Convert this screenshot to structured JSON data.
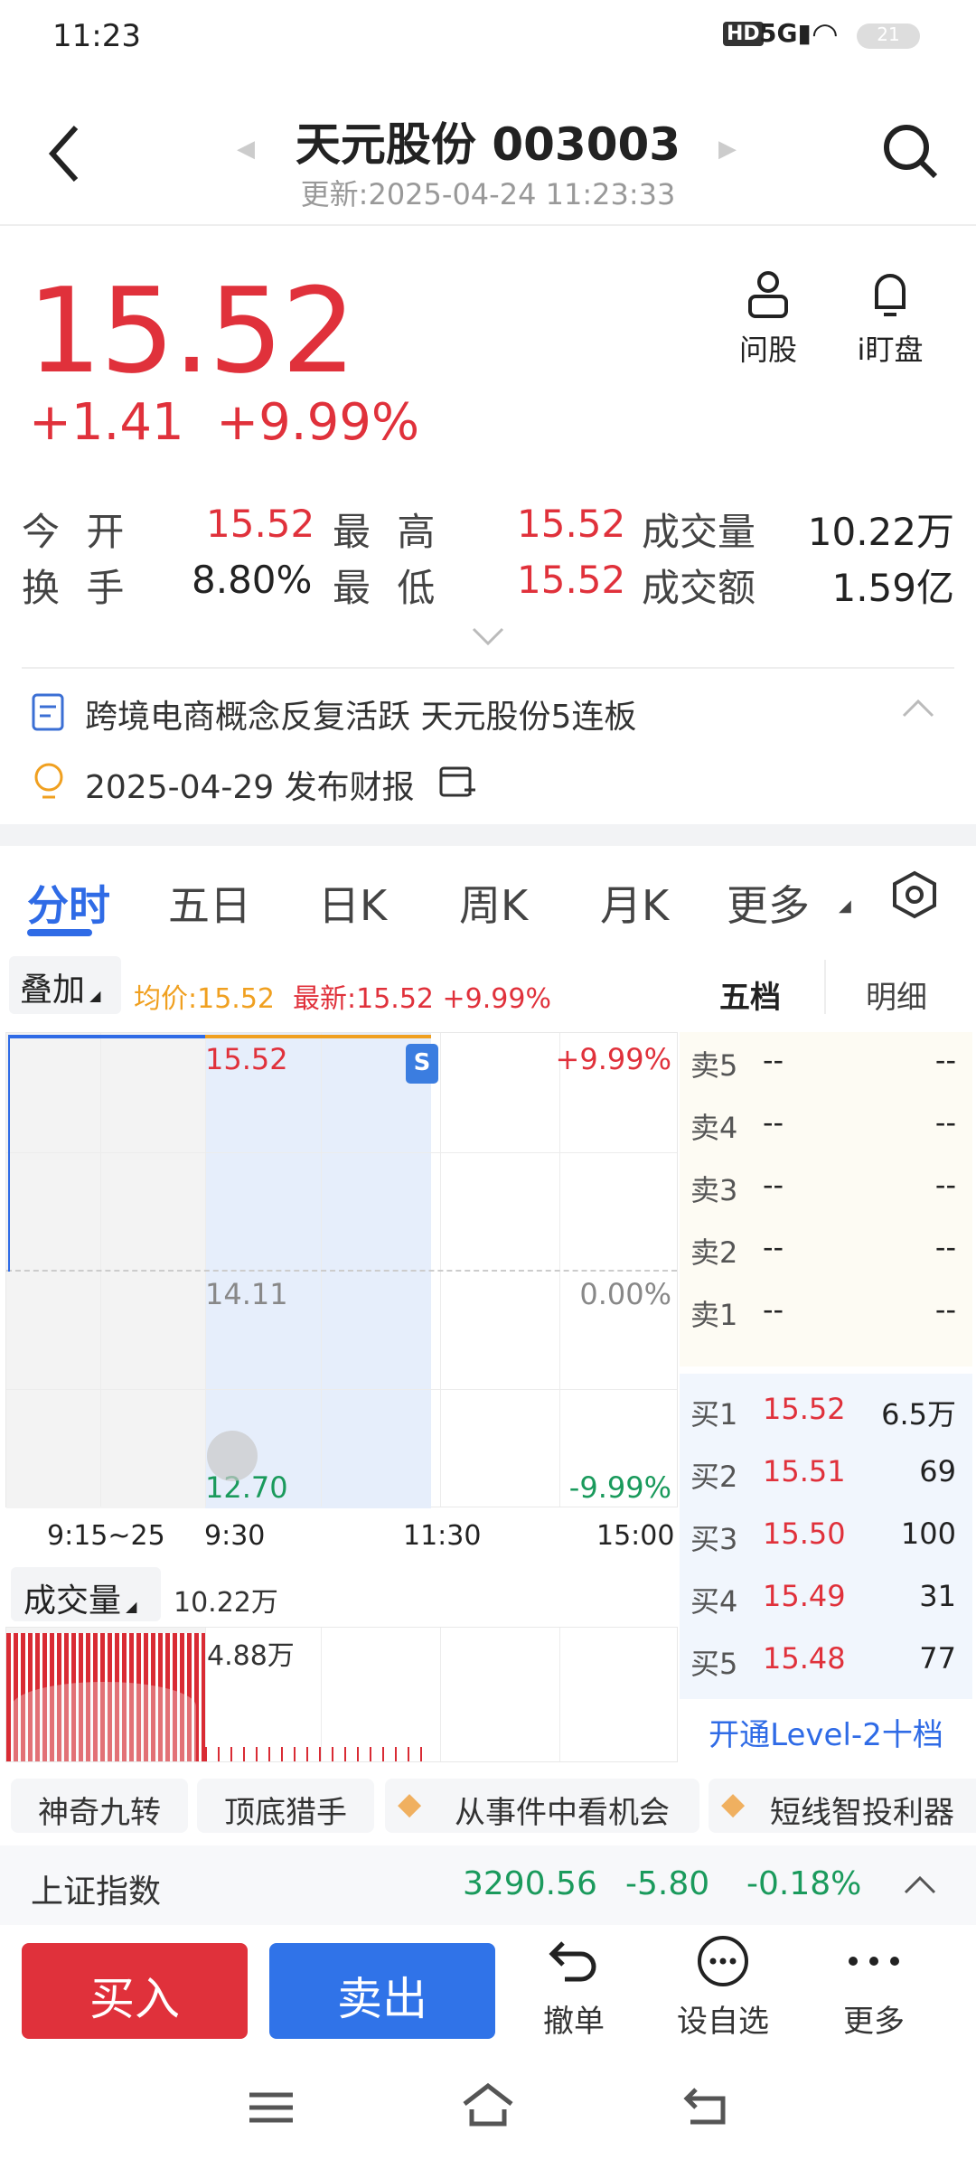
{
  "status": {
    "time": "11:23",
    "battery": "21"
  },
  "header": {
    "title": "天元股份 003003",
    "updated": "更新:2025-04-24 11:23:33"
  },
  "price": {
    "last": "15.52",
    "change": "+1.41",
    "pct": "+9.99%"
  },
  "actions": {
    "ask": "问股",
    "watch": "i盯盘"
  },
  "quote": {
    "open_label": "今 开",
    "open": "15.52",
    "high_label": "最 高",
    "high": "15.52",
    "vol_label": "成交量",
    "vol": "10.22万",
    "turn_label": "换 手",
    "turn": "8.80%",
    "low_label": "最 低",
    "low": "15.52",
    "amt_label": "成交额",
    "amt": "1.59亿"
  },
  "news": {
    "headline": "跨境电商概念反复活跃 天元股份5连板",
    "event": "2025-04-29 发布财报"
  },
  "tabs": [
    "分时",
    "五日",
    "日K",
    "周K",
    "月K",
    "更多"
  ],
  "overlay": {
    "label": "叠加",
    "avg": "均价:15.52",
    "latest": "最新:15.52 +9.99%"
  },
  "obtabs": {
    "five": "五档",
    "detail": "明细"
  },
  "chart": {
    "top_price": "15.52",
    "top_pct": "+9.99%",
    "mid_price": "14.11",
    "mid_pct": "0.00%",
    "low_price": "12.70",
    "low_pct": "-9.99%",
    "times": [
      "9:15~25",
      "9:30",
      "11:30",
      "15:00"
    ],
    "vol_label": "成交量",
    "vol_total": "10.22万",
    "vol_max": "4.88万",
    "marker": "S"
  },
  "orderbook": {
    "sells": [
      {
        "l": "卖5",
        "p": "--",
        "v": "--"
      },
      {
        "l": "卖4",
        "p": "--",
        "v": "--"
      },
      {
        "l": "卖3",
        "p": "--",
        "v": "--"
      },
      {
        "l": "卖2",
        "p": "--",
        "v": "--"
      },
      {
        "l": "卖1",
        "p": "--",
        "v": "--"
      }
    ],
    "buys": [
      {
        "l": "买1",
        "p": "15.52",
        "v": "6.5万"
      },
      {
        "l": "买2",
        "p": "15.51",
        "v": "69"
      },
      {
        "l": "买3",
        "p": "15.50",
        "v": "100"
      },
      {
        "l": "买4",
        "p": "15.49",
        "v": "31"
      },
      {
        "l": "买5",
        "p": "15.48",
        "v": "77"
      }
    ],
    "level2": "开通Level-2十档"
  },
  "tags": [
    "神奇九转",
    "顶底猎手",
    "从事件中看机会",
    "短线智投利器"
  ],
  "index": {
    "name": "上证指数",
    "value": "3290.56",
    "change": "-5.80",
    "pct": "-0.18%"
  },
  "bottom": {
    "buy": "买入",
    "sell": "卖出",
    "cancel": "撤单",
    "fav": "设自选",
    "more": "更多"
  }
}
